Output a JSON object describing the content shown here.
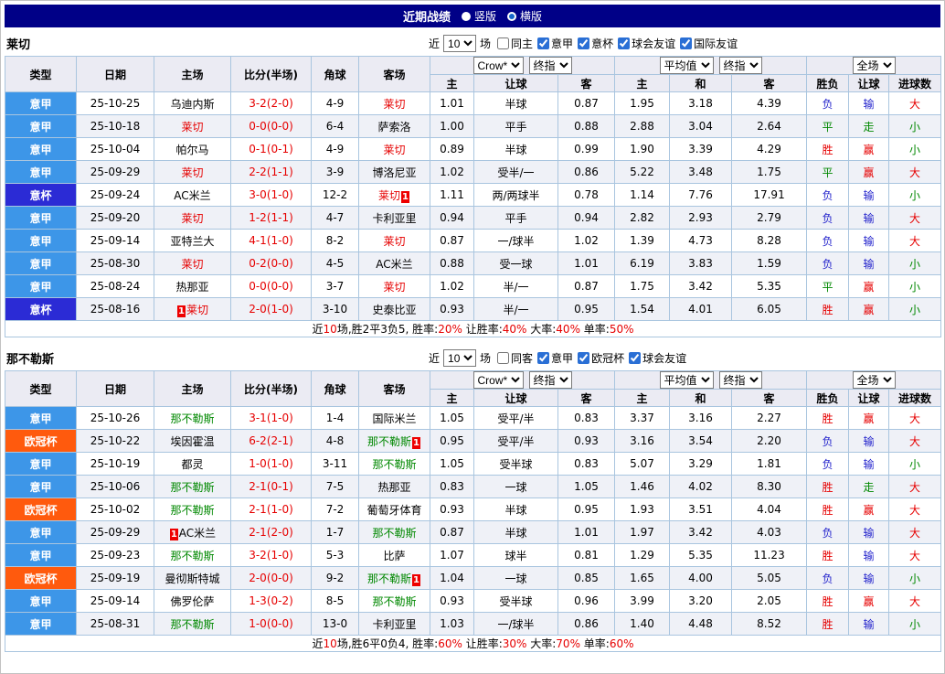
{
  "titlebar": {
    "title": "近期战绩",
    "vertical_label": "竖版",
    "horizontal_label": "横版",
    "selected": "横版"
  },
  "colors": {
    "league": {
      "意甲": "#3d96e8",
      "意杯": "#2b2bd5",
      "欧冠杯": "#ff5a0d"
    },
    "outcome": {
      "胜": "#e60000",
      "赢": "#e60000",
      "大": "#e60000",
      "平": "#008800",
      "走": "#008800",
      "小": "#008800",
      "负": "#2323cc",
      "输": "#2323cc"
    },
    "score": "#e60000"
  },
  "columns": [
    "类型",
    "日期",
    "主场",
    "比分(半场)",
    "角球",
    "客场",
    "主",
    "让球",
    "客",
    "主",
    "和",
    "客",
    "胜负",
    "让球",
    "进球数"
  ],
  "header_groups": {
    "book": "Crow*",
    "book_final": "终指",
    "avg": "平均值",
    "avg_final": "终指",
    "scope": "全场"
  },
  "sections": [
    {
      "team": "莱切",
      "focus_color": "#e60000",
      "filter": {
        "near": "近",
        "games": "10",
        "unit": "场",
        "same": {
          "label": "同主",
          "checked": false
        },
        "competitions": [
          {
            "label": "意甲",
            "checked": true
          },
          {
            "label": "意杯",
            "checked": true
          },
          {
            "label": "球会友谊",
            "checked": true
          },
          {
            "label": "国际友谊",
            "checked": true
          }
        ]
      },
      "rows": [
        {
          "league": "意甲",
          "date": "25-10-25",
          "home": "乌迪内斯",
          "score": "3-2(2-0)",
          "corners": "4-9",
          "away": "莱切",
          "away_focus": true,
          "odds": [
            "1.01",
            "半球",
            "0.87",
            "1.95",
            "3.18",
            "4.39"
          ],
          "outcome": [
            "负",
            "输",
            "大"
          ]
        },
        {
          "league": "意甲",
          "date": "25-10-18",
          "home": "莱切",
          "home_focus": true,
          "score": "0-0(0-0)",
          "corners": "6-4",
          "away": "萨索洛",
          "odds": [
            "1.00",
            "平手",
            "0.88",
            "2.88",
            "3.04",
            "2.64"
          ],
          "outcome": [
            "平",
            "走",
            "小"
          ]
        },
        {
          "league": "意甲",
          "date": "25-10-04",
          "home": "帕尔马",
          "score": "0-1(0-1)",
          "corners": "4-9",
          "away": "莱切",
          "away_focus": true,
          "odds": [
            "0.89",
            "半球",
            "0.99",
            "1.90",
            "3.39",
            "4.29"
          ],
          "outcome": [
            "胜",
            "赢",
            "小"
          ]
        },
        {
          "league": "意甲",
          "date": "25-09-29",
          "home": "莱切",
          "home_focus": true,
          "score": "2-2(1-1)",
          "corners": "3-9",
          "away": "博洛尼亚",
          "odds": [
            "1.02",
            "受半/一",
            "0.86",
            "5.22",
            "3.48",
            "1.75"
          ],
          "outcome": [
            "平",
            "赢",
            "大"
          ]
        },
        {
          "league": "意杯",
          "date": "25-09-24",
          "home": "AC米兰",
          "score": "3-0(1-0)",
          "corners": "12-2",
          "away": "莱切",
          "away_focus": true,
          "away_card": "1",
          "odds": [
            "1.11",
            "两/两球半",
            "0.78",
            "1.14",
            "7.76",
            "17.91"
          ],
          "outcome": [
            "负",
            "输",
            "小"
          ]
        },
        {
          "league": "意甲",
          "date": "25-09-20",
          "home": "莱切",
          "home_focus": true,
          "score": "1-2(1-1)",
          "corners": "4-7",
          "away": "卡利亚里",
          "odds": [
            "0.94",
            "平手",
            "0.94",
            "2.82",
            "2.93",
            "2.79"
          ],
          "outcome": [
            "负",
            "输",
            "大"
          ]
        },
        {
          "league": "意甲",
          "date": "25-09-14",
          "home": "亚特兰大",
          "score": "4-1(1-0)",
          "corners": "8-2",
          "away": "莱切",
          "away_focus": true,
          "odds": [
            "0.87",
            "一/球半",
            "1.02",
            "1.39",
            "4.73",
            "8.28"
          ],
          "outcome": [
            "负",
            "输",
            "大"
          ]
        },
        {
          "league": "意甲",
          "date": "25-08-30",
          "home": "莱切",
          "home_focus": true,
          "score": "0-2(0-0)",
          "corners": "4-5",
          "away": "AC米兰",
          "odds": [
            "0.88",
            "受一球",
            "1.01",
            "6.19",
            "3.83",
            "1.59"
          ],
          "outcome": [
            "负",
            "输",
            "小"
          ]
        },
        {
          "league": "意甲",
          "date": "25-08-24",
          "home": "热那亚",
          "score": "0-0(0-0)",
          "corners": "3-7",
          "away": "莱切",
          "away_focus": true,
          "odds": [
            "1.02",
            "半/一",
            "0.87",
            "1.75",
            "3.42",
            "5.35"
          ],
          "outcome": [
            "平",
            "赢",
            "小"
          ]
        },
        {
          "league": "意杯",
          "date": "25-08-16",
          "home": "莱切",
          "home_focus": true,
          "home_card": "1",
          "score": "2-0(1-0)",
          "corners": "3-10",
          "away": "史泰比亚",
          "odds": [
            "0.93",
            "半/一",
            "0.95",
            "1.54",
            "4.01",
            "6.05"
          ],
          "outcome": [
            "胜",
            "赢",
            "小"
          ]
        }
      ],
      "summary": [
        {
          "text": "近"
        },
        {
          "text": "10",
          "red": true
        },
        {
          "text": "场,胜2平3负5, 胜率:"
        },
        {
          "text": "20%",
          "red": true
        },
        {
          "text": " 让胜率:"
        },
        {
          "text": "40%",
          "red": true
        },
        {
          "text": " 大率:"
        },
        {
          "text": "40%",
          "red": true
        },
        {
          "text": " 单率:"
        },
        {
          "text": "50%",
          "red": true
        }
      ]
    },
    {
      "team": "那不勒斯",
      "focus_color": "#008800",
      "filter": {
        "near": "近",
        "games": "10",
        "unit": "场",
        "same": {
          "label": "同客",
          "checked": false
        },
        "competitions": [
          {
            "label": "意甲",
            "checked": true
          },
          {
            "label": "欧冠杯",
            "checked": true
          },
          {
            "label": "球会友谊",
            "checked": true
          }
        ]
      },
      "rows": [
        {
          "league": "意甲",
          "date": "25-10-26",
          "home": "那不勒斯",
          "home_focus": true,
          "score": "3-1(1-0)",
          "corners": "1-4",
          "away": "国际米兰",
          "odds": [
            "1.05",
            "受平/半",
            "0.83",
            "3.37",
            "3.16",
            "2.27"
          ],
          "outcome": [
            "胜",
            "赢",
            "大"
          ]
        },
        {
          "league": "欧冠杯",
          "date": "25-10-22",
          "home": "埃因霍温",
          "score": "6-2(2-1)",
          "corners": "4-8",
          "away": "那不勒斯",
          "away_focus": true,
          "away_card": "1",
          "odds": [
            "0.95",
            "受平/半",
            "0.93",
            "3.16",
            "3.54",
            "2.20"
          ],
          "outcome": [
            "负",
            "输",
            "大"
          ]
        },
        {
          "league": "意甲",
          "date": "25-10-19",
          "home": "都灵",
          "score": "1-0(1-0)",
          "corners": "3-11",
          "away": "那不勒斯",
          "away_focus": true,
          "odds": [
            "1.05",
            "受半球",
            "0.83",
            "5.07",
            "3.29",
            "1.81"
          ],
          "outcome": [
            "负",
            "输",
            "小"
          ]
        },
        {
          "league": "意甲",
          "date": "25-10-06",
          "home": "那不勒斯",
          "home_focus": true,
          "score": "2-1(0-1)",
          "corners": "7-5",
          "away": "热那亚",
          "odds": [
            "0.83",
            "一球",
            "1.05",
            "1.46",
            "4.02",
            "8.30"
          ],
          "outcome": [
            "胜",
            "走",
            "大"
          ]
        },
        {
          "league": "欧冠杯",
          "date": "25-10-02",
          "home": "那不勒斯",
          "home_focus": true,
          "score": "2-1(1-0)",
          "corners": "7-2",
          "away": "葡萄牙体育",
          "odds": [
            "0.93",
            "半球",
            "0.95",
            "1.93",
            "3.51",
            "4.04"
          ],
          "outcome": [
            "胜",
            "赢",
            "大"
          ]
        },
        {
          "league": "意甲",
          "date": "25-09-29",
          "home": "AC米兰",
          "home_card": "1",
          "score": "2-1(2-0)",
          "corners": "1-7",
          "away": "那不勒斯",
          "away_focus": true,
          "odds": [
            "0.87",
            "半球",
            "1.01",
            "1.97",
            "3.42",
            "4.03"
          ],
          "outcome": [
            "负",
            "输",
            "大"
          ]
        },
        {
          "league": "意甲",
          "date": "25-09-23",
          "home": "那不勒斯",
          "home_focus": true,
          "score": "3-2(1-0)",
          "corners": "5-3",
          "away": "比萨",
          "odds": [
            "1.07",
            "球半",
            "0.81",
            "1.29",
            "5.35",
            "11.23"
          ],
          "outcome": [
            "胜",
            "输",
            "大"
          ]
        },
        {
          "league": "欧冠杯",
          "date": "25-09-19",
          "home": "曼彻斯特城",
          "score": "2-0(0-0)",
          "corners": "9-2",
          "away": "那不勒斯",
          "away_focus": true,
          "away_card": "1",
          "odds": [
            "1.04",
            "一球",
            "0.85",
            "1.65",
            "4.00",
            "5.05"
          ],
          "outcome": [
            "负",
            "输",
            "小"
          ]
        },
        {
          "league": "意甲",
          "date": "25-09-14",
          "home": "佛罗伦萨",
          "score": "1-3(0-2)",
          "corners": "8-5",
          "away": "那不勒斯",
          "away_focus": true,
          "odds": [
            "0.93",
            "受半球",
            "0.96",
            "3.99",
            "3.20",
            "2.05"
          ],
          "outcome": [
            "胜",
            "赢",
            "大"
          ]
        },
        {
          "league": "意甲",
          "date": "25-08-31",
          "home": "那不勒斯",
          "home_focus": true,
          "score": "1-0(0-0)",
          "corners": "13-0",
          "away": "卡利亚里",
          "odds": [
            "1.03",
            "一/球半",
            "0.86",
            "1.40",
            "4.48",
            "8.52"
          ],
          "outcome": [
            "胜",
            "输",
            "小"
          ]
        }
      ],
      "summary": [
        {
          "text": "近"
        },
        {
          "text": "10",
          "red": true
        },
        {
          "text": "场,胜6平0负4, 胜率:"
        },
        {
          "text": "60%",
          "red": true
        },
        {
          "text": " 让胜率:"
        },
        {
          "text": "30%",
          "red": true
        },
        {
          "text": " 大率:"
        },
        {
          "text": "70%",
          "red": true
        },
        {
          "text": " 单率:"
        },
        {
          "text": "60%",
          "red": true
        }
      ]
    }
  ]
}
